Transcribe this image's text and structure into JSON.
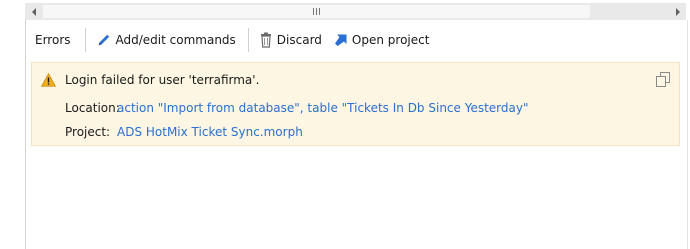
{
  "panel": {
    "title": "Errors"
  },
  "toolbar": {
    "add_edit_label": "Add/edit commands",
    "discard_label": "Discard",
    "open_project_label": "Open project"
  },
  "error": {
    "message": "Login failed for user 'terrafirma'.",
    "location_label": "Location:",
    "location_value": "action \"Import from database\", table \"Tickets In Db Since Yesterday\"",
    "project_label": "Project:",
    "project_value": "ADS HotMix Ticket Sync.morph"
  },
  "colors": {
    "link": "#2a6fd1",
    "error_background": "#fdf6e2",
    "warning_icon": "#f2b01e"
  },
  "icons": {
    "add_edit": "pencil-icon",
    "discard": "trash-icon",
    "open_project": "arrow-up-right-icon",
    "warning": "warning-triangle-icon",
    "copy": "copy-icon"
  }
}
